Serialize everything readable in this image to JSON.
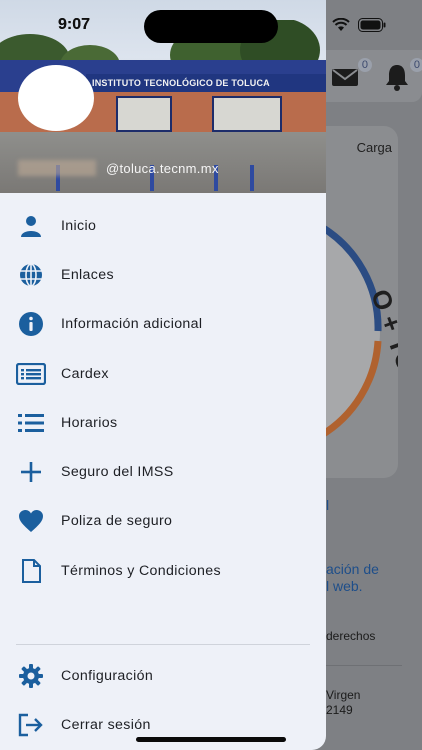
{
  "status_bar": {
    "time": "9:07"
  },
  "drawer": {
    "header": {
      "building_sign": "INSTITUTO TECNOLÓGICO DE TOLUCA",
      "email": "@toluca.tecnm.mx"
    },
    "menu": [
      {
        "label": "Inicio",
        "icon": "person-icon"
      },
      {
        "label": "Enlaces",
        "icon": "globe-icon"
      },
      {
        "label": "Información adicional",
        "icon": "info-icon"
      },
      {
        "label": "Cardex",
        "icon": "list-card-icon"
      },
      {
        "label": "Horarios",
        "icon": "list-icon"
      },
      {
        "label": "Seguro del IMSS",
        "icon": "plus-icon"
      },
      {
        "label": "Poliza de seguro",
        "icon": "heart-icon"
      },
      {
        "label": "Términos y Condiciones",
        "icon": "document-icon"
      }
    ],
    "bottom_menu": [
      {
        "label": "Configuración",
        "icon": "gear-icon"
      },
      {
        "label": "Cerrar sesión",
        "icon": "logout-icon"
      }
    ]
  },
  "background": {
    "mail_badge": "0",
    "bell_badge": "0",
    "card_label": "Carga",
    "logo_text": "O + TOLUCA",
    "partial_text_1": "l",
    "link_text_1": "ación de",
    "link_text_2": "l web.",
    "rights_text": "derechos",
    "footer_line_1": "Virgen",
    "footer_line_2": "2149"
  },
  "colors": {
    "icon_blue": "#1b5f9e",
    "drawer_bg": "#eef1f8",
    "text": "#1d1f24"
  }
}
